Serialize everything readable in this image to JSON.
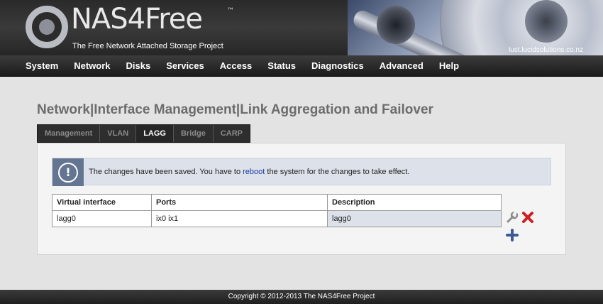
{
  "header": {
    "logo_text": "NAS4Free",
    "logo_tm": "™",
    "tagline": "The Free Network Attached Storage Project",
    "hostname": "lust.lucidsolutions.co.nz"
  },
  "nav": {
    "items": [
      "System",
      "Network",
      "Disks",
      "Services",
      "Access",
      "Status",
      "Diagnostics",
      "Advanced",
      "Help"
    ]
  },
  "page": {
    "title": "Network|Interface Management|Link Aggregation and Failover"
  },
  "tabs": {
    "items": [
      "Management",
      "VLAN",
      "LAGG",
      "Bridge",
      "CARP"
    ],
    "active": "LAGG"
  },
  "notice": {
    "text_before": "The changes have been saved. You have to ",
    "link": "reboot",
    "text_after": " the system for the changes to take effect."
  },
  "table": {
    "headers": [
      "Virtual interface",
      "Ports",
      "Description"
    ],
    "rows": [
      {
        "interface": "lagg0",
        "ports": "ix0 ix1",
        "description": "lagg0"
      }
    ]
  },
  "icons": {
    "notice": "info-exclamation-icon",
    "edit": "wrench-icon",
    "delete": "red-x-icon",
    "add": "plus-icon"
  },
  "colors": {
    "notice_accent": "#647592",
    "delete": "#cc1f1f",
    "add": "#3f5a93"
  },
  "footer": {
    "copyright": "Copyright © 2012-2013 The NAS4Free Project"
  }
}
